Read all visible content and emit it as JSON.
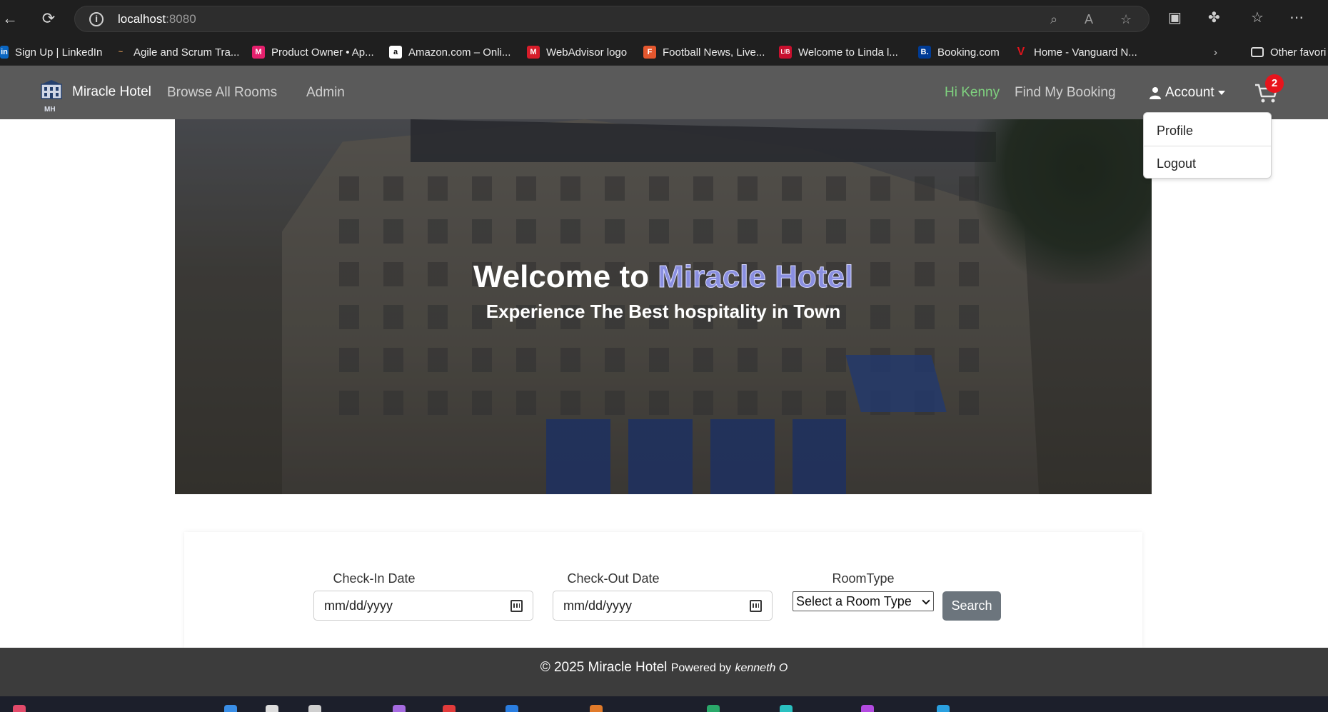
{
  "browser": {
    "url_host": "localhost",
    "url_port": ":8080",
    "bookmarks": [
      {
        "label": "Sign Up | LinkedIn",
        "color": "#0a66c2",
        "glyph": "in"
      },
      {
        "label": "Agile and Scrum Tra...",
        "color": "#b0703a",
        "glyph": "~"
      },
      {
        "label": "Product Owner • Ap...",
        "color": "#e5206d",
        "glyph": "M"
      },
      {
        "label": "Amazon.com – Onli...",
        "color": "#ffffff",
        "glyph": "a"
      },
      {
        "label": "WebAdvisor logo",
        "color": "#d71d2a",
        "glyph": "M"
      },
      {
        "label": "Football News, Live...",
        "color": "#e4572e",
        "glyph": "F"
      },
      {
        "label": "Welcome to Linda l...",
        "color": "#c8102e",
        "glyph": "LIB"
      },
      {
        "label": "Booking.com",
        "color": "#003b95",
        "glyph": "B."
      },
      {
        "label": "Home - Vanguard N...",
        "color": "#c8102e",
        "glyph": "V"
      }
    ],
    "other_favorites": "Other favori"
  },
  "site": {
    "brand": "Miracle Hotel",
    "logo_text": "MH",
    "nav": {
      "browse": "Browse All Rooms",
      "admin": "Admin",
      "greeting": "Hi Kenny",
      "find_booking": "Find My Booking",
      "account": "Account",
      "cart_count": "2"
    },
    "dropdown": {
      "profile": "Profile",
      "logout": "Logout"
    },
    "hero": {
      "title_prefix": "Welcome to",
      "title_accent": "Miracle Hotel",
      "subtitle": "Experience The Best hospitality in Town"
    },
    "search": {
      "checkin_label": "Check-In Date",
      "checkin_placeholder": "mm/dd/yyyy",
      "checkout_label": "Check-Out Date",
      "checkout_placeholder": "mm/dd/yyyy",
      "roomtype_label": "RoomType",
      "roomtype_selected": "Select a Room Type",
      "button": "Search"
    },
    "footer": {
      "copyright": "© 2025 Miracle Hotel",
      "powered": "Powered by",
      "author": "kenneth O"
    }
  },
  "colors": {
    "accent": "#8a8fe0",
    "greeting": "#7fd27f",
    "badge": "#e8141c",
    "button": "#6c757d"
  }
}
